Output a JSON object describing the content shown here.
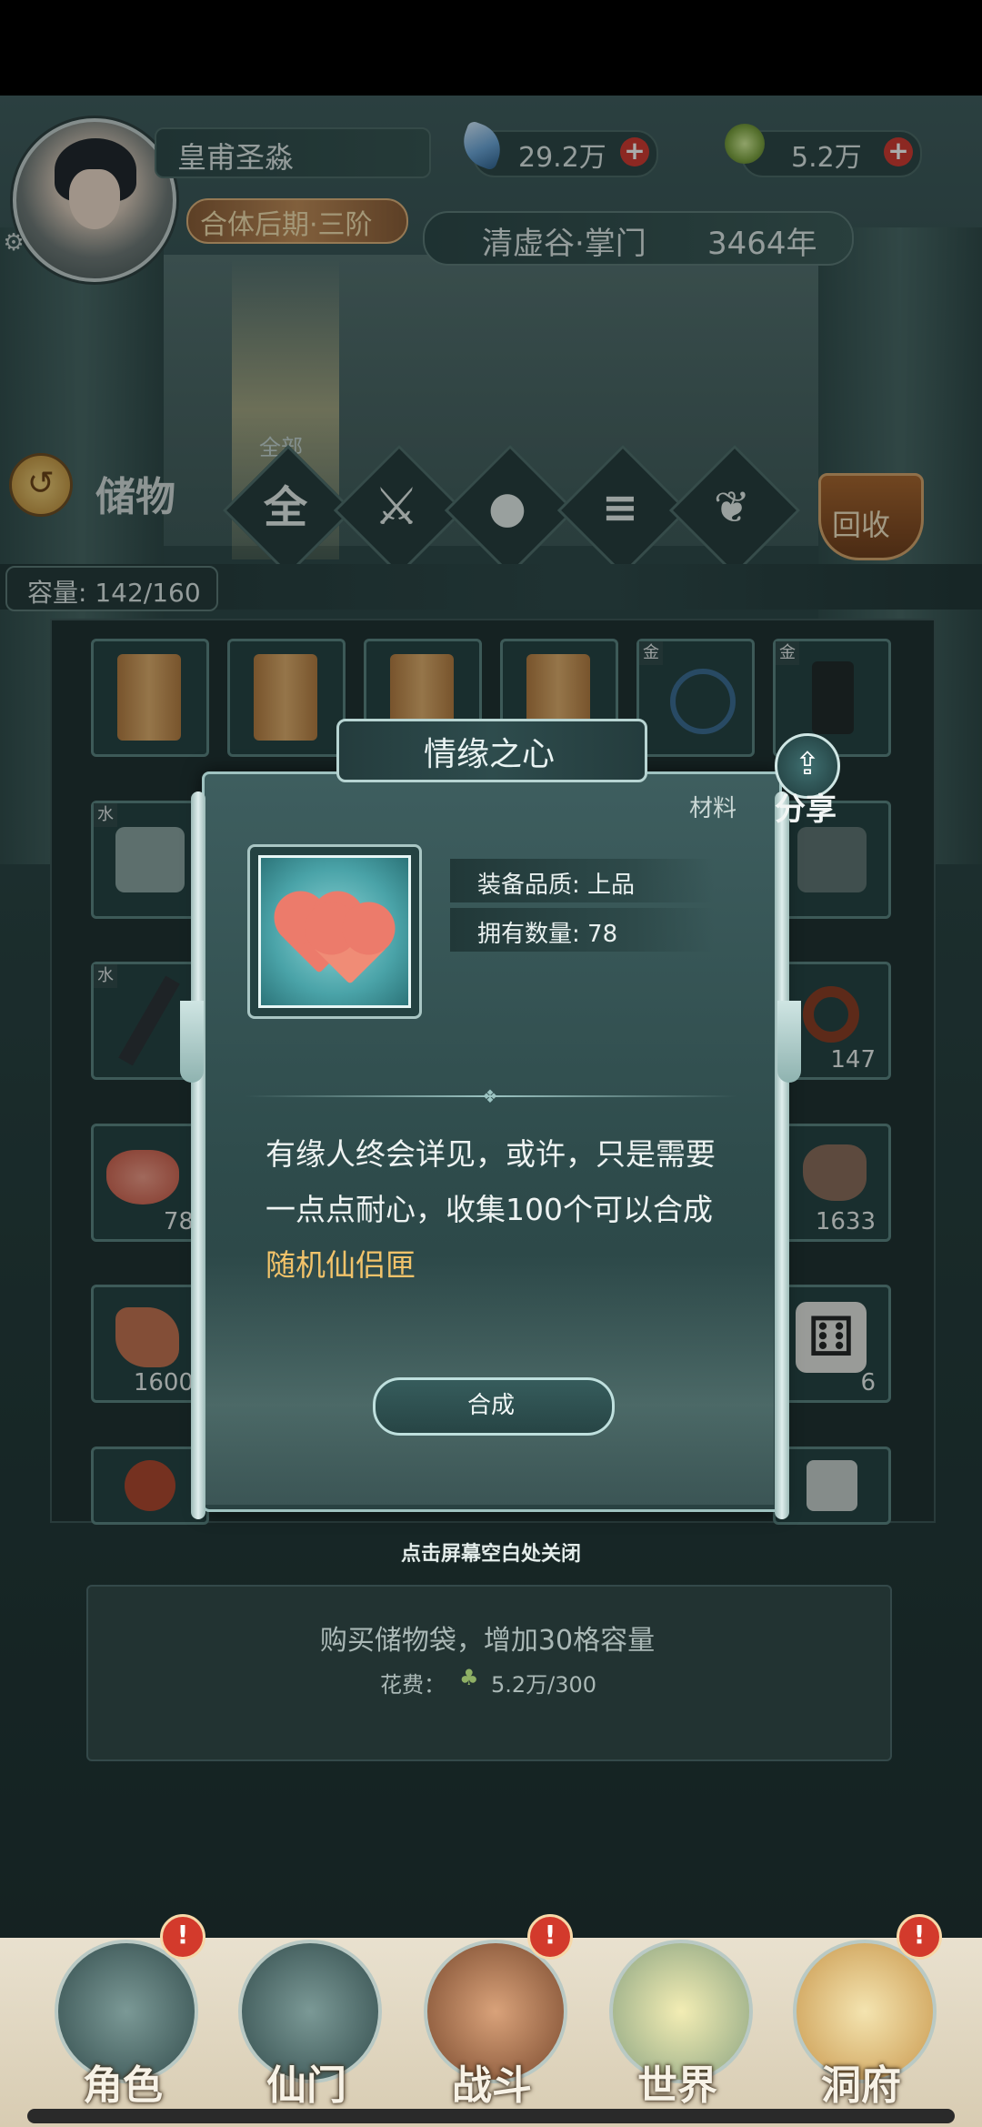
{
  "header": {
    "player_name": "皇甫圣淼",
    "realm": "合体后期·三阶",
    "currency1": {
      "value": "29.2万",
      "icon": "crystal-icon"
    },
    "currency2": {
      "value": "5.2万",
      "icon": "spirit-herb-icon"
    },
    "sect_title": "清虚谷·掌门",
    "age": "3464年"
  },
  "storage": {
    "title": "储物",
    "active_category_label": "全部",
    "categories": [
      "全",
      "兵",
      "丹",
      "卷",
      "草"
    ],
    "recycle_label": "回收",
    "capacity": "容量: 142/160"
  },
  "grid": {
    "counts": [
      "78",
      "1633",
      "1600",
      "6",
      "147"
    ],
    "tags": [
      "金",
      "金",
      "水",
      "水"
    ]
  },
  "dialog": {
    "title": "情缘之心",
    "type": "材料",
    "share_label": "分享",
    "quality": "装备品质: 上品",
    "owned": "拥有数量: 78",
    "desc_main": "有缘人终会详见，或许，只是需要一点点耐心，收集100个可以合成",
    "desc_highlight": "随机仙侣匣",
    "synth_button": "合成",
    "close_hint": "点击屏幕空白处关闭"
  },
  "buy": {
    "text": "购买储物袋，增加30格容量",
    "cost_label": "花费：",
    "cost_value": "5.2万/300"
  },
  "nav": {
    "items": [
      "角色",
      "仙门",
      "战斗",
      "世界",
      "洞府"
    ],
    "badge": "!"
  },
  "colors": {
    "accent_gold": "#f2c36a",
    "badge_red": "#d33a2c",
    "panel_teal": "#2e4b4b"
  }
}
